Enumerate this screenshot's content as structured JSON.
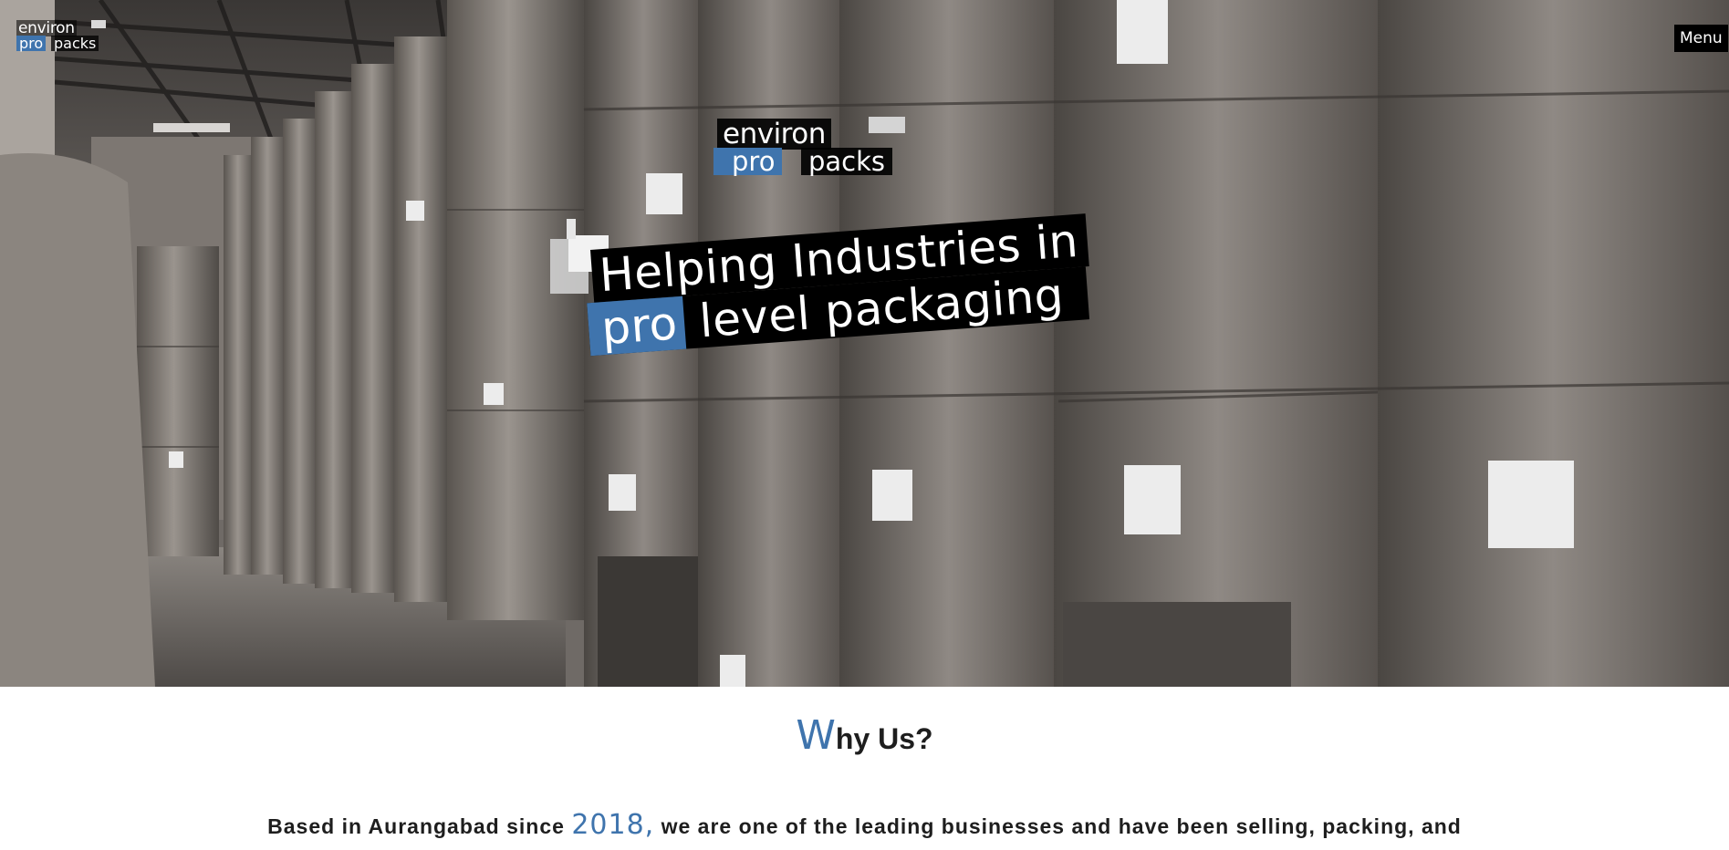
{
  "header": {
    "logo_small": {
      "line1": "environ",
      "line2a": "pro",
      "line2b": "packs"
    },
    "menu_label": "Menu"
  },
  "hero": {
    "logo_large": {
      "line1": "environ",
      "line2a": "pro",
      "line2b": "packs"
    },
    "tagline": {
      "line1": "Helping Industries in",
      "line2_highlight": "pro",
      "line2_rest": " level packaging"
    }
  },
  "why_us": {
    "title_initial": "W",
    "title_rest": "hy Us?",
    "text_before": "Based in Aurangabad since ",
    "year": "2018,",
    "text_after": " we are one of the leading businesses and have been selling, packing, and"
  },
  "colors": {
    "accent": "#3f74ad",
    "text": "#1e1e1e",
    "menu_bg": "#000000"
  }
}
